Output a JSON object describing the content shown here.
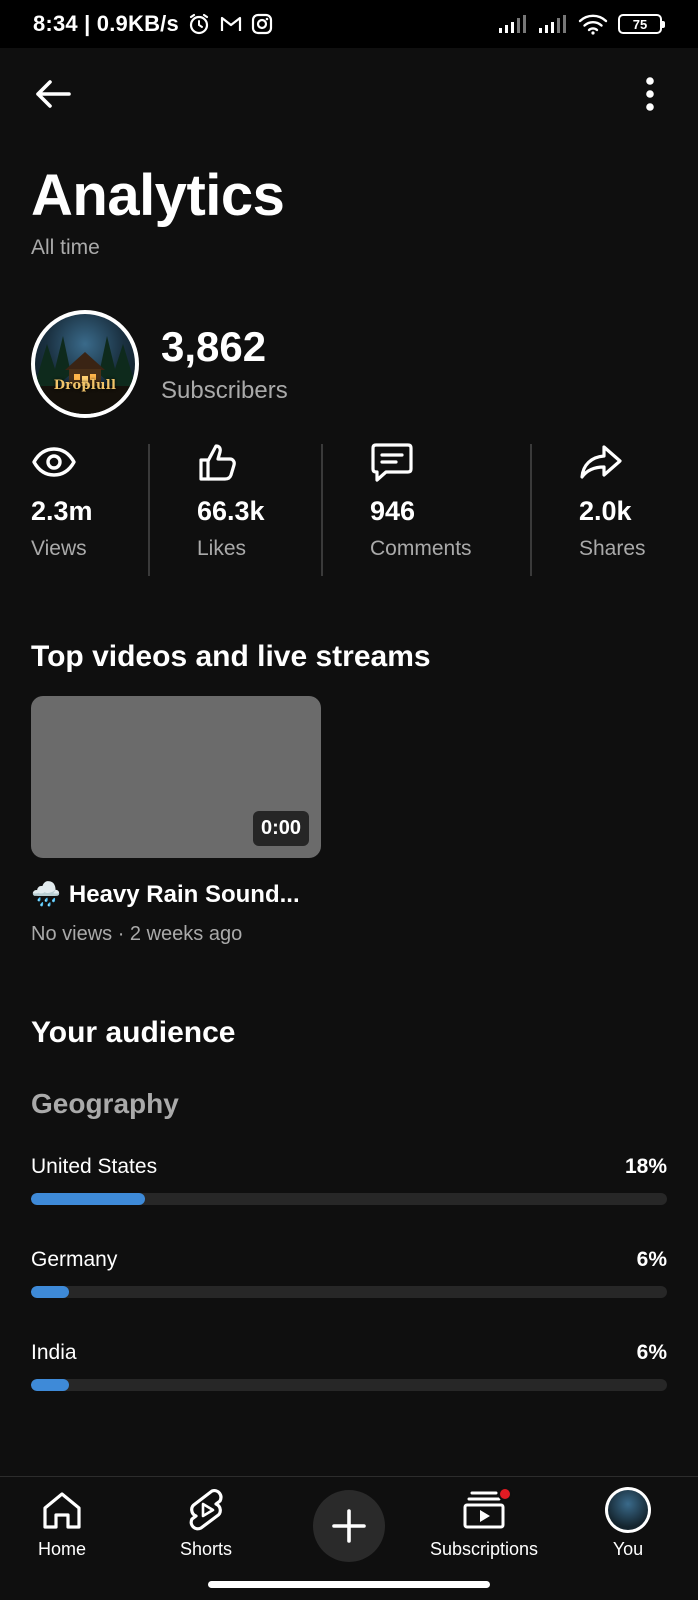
{
  "status_bar": {
    "time_speed": "8:34 | 0.9KB/s",
    "battery": "75"
  },
  "header": {
    "title": "Analytics",
    "subtitle": "All time"
  },
  "channel": {
    "avatar_text": "Droplull",
    "subscriber_count": "3,862",
    "subscriber_label": "Subscribers"
  },
  "metrics": [
    {
      "icon": "eye-icon",
      "value": "2.3m",
      "label": "Views"
    },
    {
      "icon": "thumbs-up-icon",
      "value": "66.3k",
      "label": "Likes"
    },
    {
      "icon": "comment-icon",
      "value": "946",
      "label": "Comments"
    },
    {
      "icon": "share-icon",
      "value": "2.0k",
      "label": "Shares"
    }
  ],
  "top_videos": {
    "title": "Top videos and live streams",
    "items": [
      {
        "duration": "0:00",
        "emoji": "🌧️",
        "title": "Heavy Rain Sound...",
        "meta": "No views · 2 weeks ago"
      }
    ]
  },
  "audience": {
    "title": "Your audience",
    "geography_label": "Geography",
    "geography": [
      {
        "country": "United States",
        "percent_text": "18%",
        "percent": 18
      },
      {
        "country": "Germany",
        "percent_text": "6%",
        "percent": 6
      },
      {
        "country": "India",
        "percent_text": "6%",
        "percent": 6
      }
    ],
    "bar_color": "#3e8ad8"
  },
  "bottom_nav": {
    "home": "Home",
    "shorts": "Shorts",
    "subscriptions": "Subscriptions",
    "you": "You"
  },
  "colors": {
    "background": "#0f0f0f",
    "text_secondary": "#aaaaaa",
    "notification_dot": "#e21b23"
  }
}
